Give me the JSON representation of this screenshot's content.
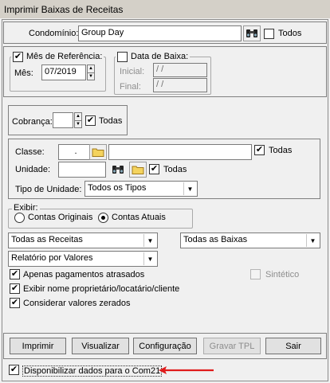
{
  "window": {
    "title": "Imprimir Baixas de Receitas"
  },
  "condominio": {
    "label": "Condomínio:",
    "value": "Group Day",
    "todos_label": "Todos",
    "todos_checked": false
  },
  "mes_referencia": {
    "label": "Mês de Referência:",
    "checked": true,
    "mes_label": "Mês:",
    "mes_value": "07/2019"
  },
  "data_baixa": {
    "label": "Data de Baixa:",
    "checked": false,
    "inicial_label": "Inicial:",
    "inicial_value": " / /",
    "final_label": "Final:",
    "final_value": " / /"
  },
  "cobranca": {
    "label": "Cobrança:",
    "value": "",
    "todas_label": "Todas",
    "todas_checked": true
  },
  "classe": {
    "label": "Classe:",
    "code": ".",
    "name": "",
    "todas_label": "Todas",
    "todas_checked": true
  },
  "unidade": {
    "label": "Unidade:",
    "value": "",
    "todas_label": "Todas",
    "todas_checked": true
  },
  "tipo_unidade": {
    "label": "Tipo de Unidade:",
    "selected": "Todos os Tipos"
  },
  "exibir": {
    "label": "Exibir:",
    "options": [
      "Contas Originais",
      "Contas Atuais"
    ],
    "selected_index": 1
  },
  "filters": {
    "receitas": "Todas as Receitas",
    "baixas": "Todas as Baixas",
    "relatorio": "Relatório por Valores"
  },
  "options": {
    "apenas_atrasados": {
      "label": "Apenas pagamentos atrasados",
      "checked": true
    },
    "sintetico": {
      "label": "Sintético",
      "checked": false
    },
    "exibir_nome": {
      "label": "Exibir nome proprietário/locatário/cliente",
      "checked": true
    },
    "valores_zerados": {
      "label": "Considerar valores zerados",
      "checked": true
    }
  },
  "buttons": {
    "imprimir": "Imprimir",
    "visualizar": "Visualizar",
    "configuracao": "Configuração",
    "gravar_tpl": "Gravar TPL",
    "sair": "Sair"
  },
  "com21": {
    "label": "Disponibilizar dados para o Com21",
    "checked": true
  },
  "colors": {
    "annotation_arrow": "#e01b1b",
    "window_bg": "#f0f0f0"
  }
}
